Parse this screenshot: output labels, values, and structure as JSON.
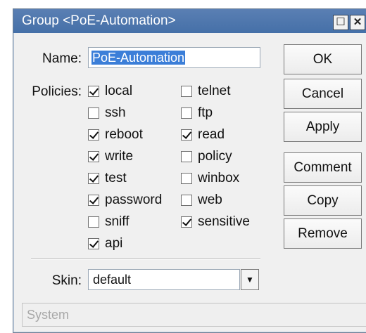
{
  "window": {
    "title": "Group <PoE-Automation>",
    "maximize_icon": "☐",
    "close_icon": "✕"
  },
  "form": {
    "name_label": "Name:",
    "name_value": "PoE-Automation",
    "policies_label": "Policies:",
    "skin_label": "Skin:",
    "skin_value": "default"
  },
  "policies": [
    {
      "label": "local",
      "checked": true
    },
    {
      "label": "ssh",
      "checked": false
    },
    {
      "label": "reboot",
      "checked": true
    },
    {
      "label": "write",
      "checked": true
    },
    {
      "label": "test",
      "checked": true
    },
    {
      "label": "password",
      "checked": true
    },
    {
      "label": "sniff",
      "checked": false
    },
    {
      "label": "api",
      "checked": true
    },
    {
      "label": "telnet",
      "checked": false
    },
    {
      "label": "ftp",
      "checked": false
    },
    {
      "label": "read",
      "checked": true
    },
    {
      "label": "policy",
      "checked": false
    },
    {
      "label": "winbox",
      "checked": false
    },
    {
      "label": "web",
      "checked": false
    },
    {
      "label": "sensitive",
      "checked": true
    }
  ],
  "buttons": {
    "ok": "OK",
    "cancel": "Cancel",
    "apply": "Apply",
    "comment": "Comment",
    "copy": "Copy",
    "remove": "Remove"
  },
  "status": {
    "text": "System"
  }
}
